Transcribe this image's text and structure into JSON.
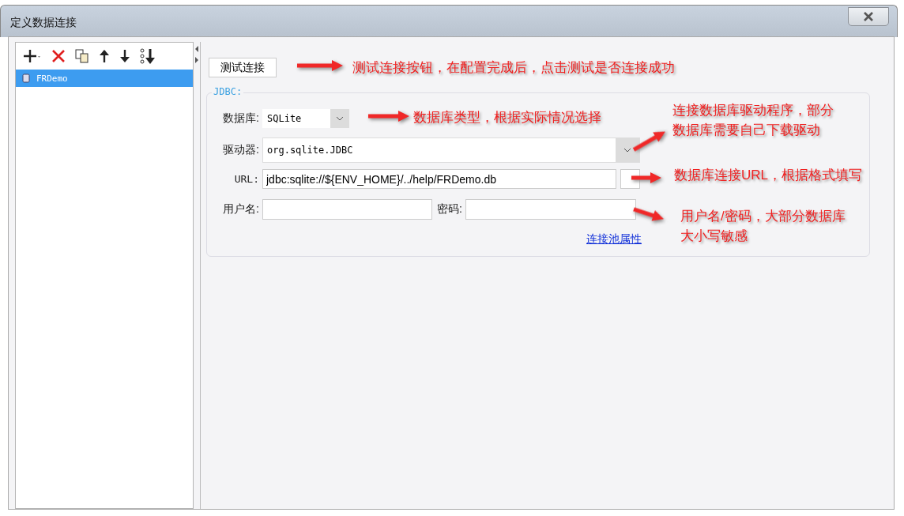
{
  "window": {
    "title": "定义数据连接"
  },
  "connections": [
    {
      "name": "FRDemo",
      "selected": true
    }
  ],
  "test_button": "测试连接",
  "jdbc": {
    "legend": "JDBC:",
    "database": {
      "label": "数据库:",
      "value": "SQLite"
    },
    "driver": {
      "label": "驱动器:",
      "value": "org.sqlite.JDBC"
    },
    "url": {
      "label": "URL:",
      "value": "jdbc:sqlite://${ENV_HOME}/../help/FRDemo.db"
    },
    "username": {
      "label": "用户名:"
    },
    "password": {
      "label": "密码:"
    },
    "pool_link": "连接池属性"
  },
  "annotations": [
    {
      "lines": [
        "测试连接按钮，在配置完成后，点击测试是否连接成功"
      ]
    },
    {
      "lines": [
        "数据库类型，根据实际情况选择"
      ]
    },
    {
      "lines": [
        "连接数据库驱动程序，部分",
        "数据库需要自己下载驱动"
      ]
    },
    {
      "lines": [
        "数据库连接URL，根据格式填写"
      ]
    },
    {
      "lines": [
        "用户名/密码，大部分数据库",
        "大小写敏感"
      ]
    }
  ]
}
